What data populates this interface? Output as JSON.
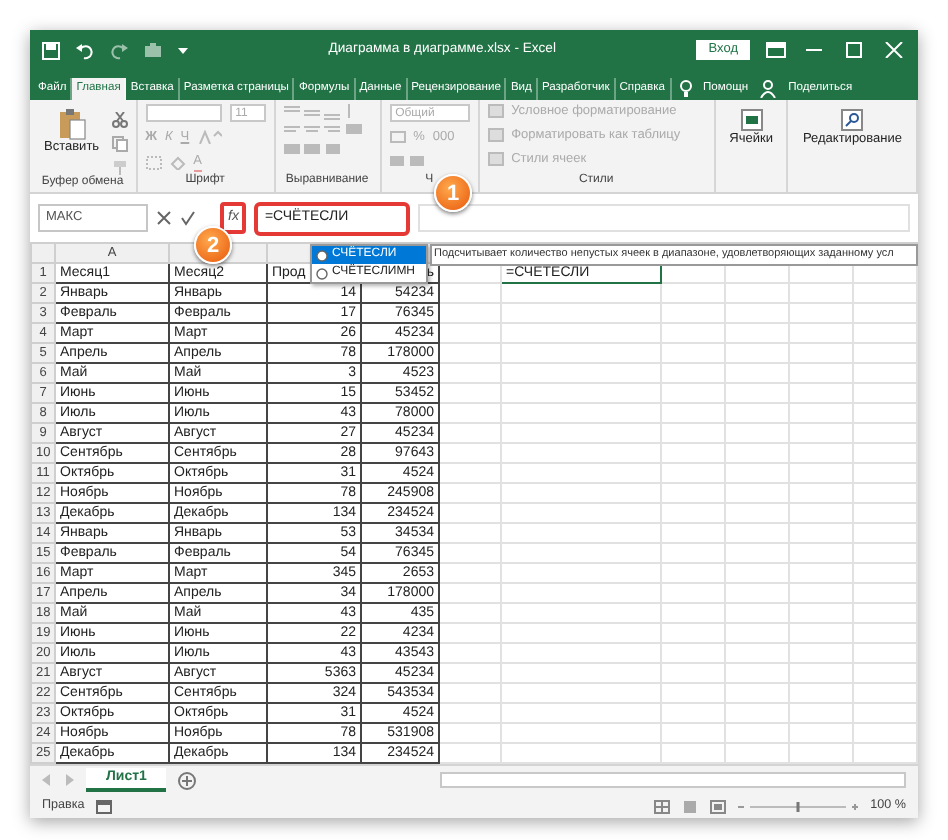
{
  "title_bar": {
    "title": "Диаграмма в диаграмме.xlsx - Excel",
    "sign_in": "Вход"
  },
  "ribbon_tabs": [
    {
      "label": "Файл",
      "selected": false
    },
    {
      "label": "Главная",
      "selected": true
    },
    {
      "label": "Вставка",
      "selected": false
    },
    {
      "label": "Разметка страницы",
      "selected": false
    },
    {
      "label": "Формулы",
      "selected": false
    },
    {
      "label": "Данные",
      "selected": false
    },
    {
      "label": "Рецензирование",
      "selected": false
    },
    {
      "label": "Вид",
      "selected": false
    },
    {
      "label": "Разработчик",
      "selected": false
    },
    {
      "label": "Справка",
      "selected": false
    }
  ],
  "tell_me": "Помощн",
  "share": "Поделиться",
  "ribbon_groups": [
    {
      "kind": "clipboard",
      "label": "Буфер обмена",
      "button": "Вставить"
    },
    {
      "kind": "font",
      "label": "Шрифт",
      "size": "11",
      "styles": [
        "Ж",
        "К",
        "Ч"
      ],
      "font_color": "А"
    },
    {
      "kind": "alignment",
      "label": "Выравнивание"
    },
    {
      "kind": "number",
      "label": "Ч",
      "format": "Общий",
      "symbols": [
        "%",
        "000"
      ]
    },
    {
      "kind": "styles",
      "label": "Стили",
      "items": [
        "Условное форматирование",
        "Форматировать как таблицу",
        "Стили ячеек"
      ]
    },
    {
      "kind": "big_button",
      "button": "Ячейки"
    },
    {
      "kind": "big_button",
      "button": "Редактирование"
    }
  ],
  "formula_bar": {
    "name_box": "МАКС",
    "fx": "fx",
    "value": "=СЧЁТЕСЛИ"
  },
  "callouts": [
    {
      "label": "1"
    },
    {
      "label": "2"
    }
  ],
  "column_headers": [
    "A"
  ],
  "rows": [
    {
      "number": "1",
      "cells": [
        "Месяц1",
        "Месяц2",
        "Прод",
        "ь"
      ]
    },
    {
      "number": "2",
      "cells": [
        "Январь",
        "Январь",
        "14",
        "54234"
      ]
    },
    {
      "number": "3",
      "cells": [
        "Февраль",
        "Февраль",
        "17",
        "76345"
      ]
    },
    {
      "number": "4",
      "cells": [
        "Март",
        "Март",
        "26",
        "45234"
      ]
    },
    {
      "number": "5",
      "cells": [
        "Апрель",
        "Апрель",
        "78",
        "178000"
      ]
    },
    {
      "number": "6",
      "cells": [
        "Май",
        "Май",
        "3",
        "4523"
      ]
    },
    {
      "number": "7",
      "cells": [
        "Июнь",
        "Июнь",
        "15",
        "53452"
      ]
    },
    {
      "number": "8",
      "cells": [
        "Июль",
        "Июль",
        "43",
        "78000"
      ]
    },
    {
      "number": "9",
      "cells": [
        "Август",
        "Август",
        "27",
        "45234"
      ]
    },
    {
      "number": "10",
      "cells": [
        "Сентябрь",
        "Сентябрь",
        "28",
        "97643"
      ]
    },
    {
      "number": "11",
      "cells": [
        "Октябрь",
        "Октябрь",
        "31",
        "4524"
      ]
    },
    {
      "number": "12",
      "cells": [
        "Ноябрь",
        "Ноябрь",
        "78",
        "245908"
      ]
    },
    {
      "number": "13",
      "cells": [
        "Декабрь",
        "Декабрь",
        "134",
        "234524"
      ]
    },
    {
      "number": "14",
      "cells": [
        "Январь",
        "Январь",
        "53",
        "34534"
      ]
    },
    {
      "number": "15",
      "cells": [
        "Февраль",
        "Февраль",
        "54",
        "76345"
      ]
    },
    {
      "number": "16",
      "cells": [
        "Март",
        "Март",
        "345",
        "2653"
      ]
    },
    {
      "number": "17",
      "cells": [
        "Апрель",
        "Апрель",
        "34",
        "178000"
      ]
    },
    {
      "number": "18",
      "cells": [
        "Май",
        "Май",
        "43",
        "435"
      ]
    },
    {
      "number": "19",
      "cells": [
        "Июнь",
        "Июнь",
        "22",
        "4234"
      ]
    },
    {
      "number": "20",
      "cells": [
        "Июль",
        "Июль",
        "43",
        "43543"
      ]
    },
    {
      "number": "21",
      "cells": [
        "Август",
        "Август",
        "5363",
        "45234"
      ]
    },
    {
      "number": "22",
      "cells": [
        "Сентябрь",
        "Сентябрь",
        "324",
        "543534"
      ]
    },
    {
      "number": "23",
      "cells": [
        "Октябрь",
        "Октябрь",
        "31",
        "4524"
      ]
    },
    {
      "number": "24",
      "cells": [
        "Ноябрь",
        "Ноябрь",
        "78",
        "531908"
      ]
    },
    {
      "number": "25",
      "cells": [
        "Декабрь",
        "Декабрь",
        "134",
        "234524"
      ]
    }
  ],
  "active_cell": {
    "value": "=СЧЁТЕСЛИ"
  },
  "autocomplete": {
    "items": [
      {
        "label": "СЧЁТЕСЛИ",
        "selected": true
      },
      {
        "label": "СЧЁТЕСЛИМН",
        "selected": false
      }
    ],
    "tooltip": "Подсчитывает количество непустых ячеек в диапазоне, удовлетворяющих заданному усл"
  },
  "sheet_tabs": [
    {
      "label": "Лист1",
      "selected": true
    }
  ],
  "status_bar": {
    "mode": "Правка",
    "zoom_slider": {
      "level": 0.5
    },
    "zoom": "100 %"
  }
}
